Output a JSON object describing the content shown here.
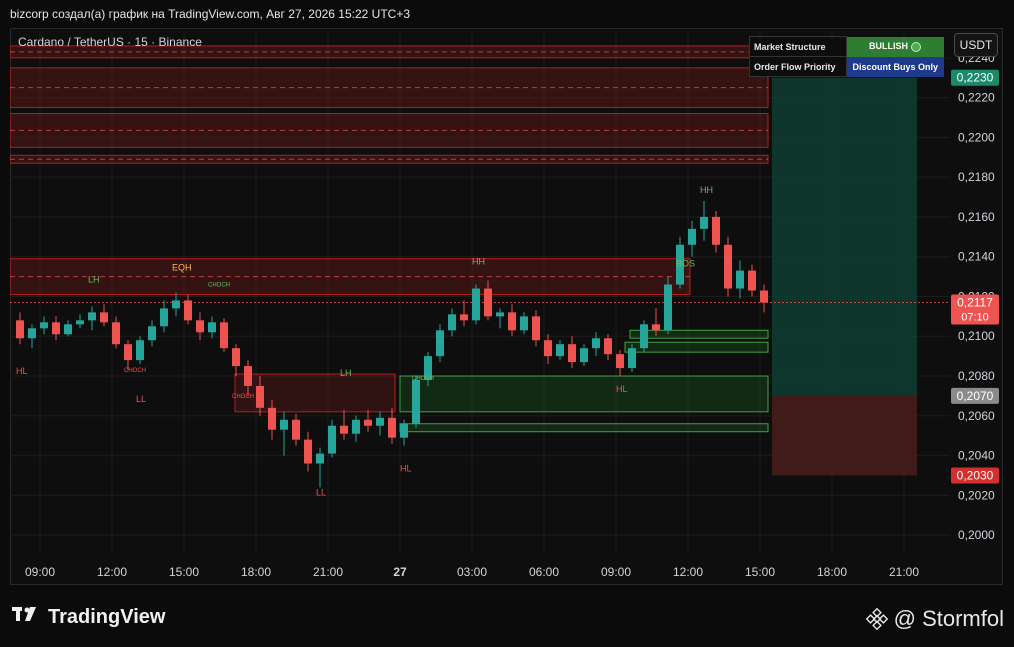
{
  "header": {
    "title": "bizcorp создал(а) график на TradingView.com, Авг 27, 2026 15:22 UTC+3"
  },
  "symbol": {
    "label": "Cardano / TetherUS · 15 · Binance"
  },
  "currency_button": "USDT",
  "info_table": {
    "row1_label": "Market Structure",
    "row1_value": "BULLISH",
    "row2_label": "Order Flow Priority",
    "row2_value": "Discount Buys Only",
    "colors": {
      "bullish": "#2e7d32",
      "discount": "#1e3a8a"
    }
  },
  "footer": {
    "brand": "TradingView",
    "author": "@ Stormfol"
  },
  "chart_data": {
    "type": "candlestick",
    "title": "Cardano / TetherUS · 15 · Binance",
    "ylim": [
      0.199,
      0.2255
    ],
    "y_ticks": [
      "0,2240",
      "0,2220",
      "0,2200",
      "0,2180",
      "0,2160",
      "0,2140",
      "0,2120",
      "0,2100",
      "0,2080",
      "0,2060",
      "0,2040",
      "0,2020",
      "0,2000"
    ],
    "x_ticks": [
      "09:00",
      "12:00",
      "15:00",
      "18:00",
      "21:00",
      "27",
      "03:00",
      "06:00",
      "09:00",
      "12:00",
      "15:00",
      "18:00",
      "21:00"
    ],
    "price_labels": {
      "target": "0,2230",
      "current": "0,2117",
      "countdown": "07:10",
      "entry": "0,2070",
      "stop": "0,2030"
    },
    "position": {
      "target": 0.223,
      "entry": 0.207,
      "stop": 0.203
    },
    "colors": {
      "up": "#26a69a",
      "down": "#ef5350",
      "bull_zone": "#1b5e20",
      "bear_zone": "#7f1d1d"
    },
    "annotations": [
      {
        "text": "HL",
        "color": "#ef5350",
        "t": 0,
        "price": 0.2081
      },
      {
        "text": "LH",
        "color": "#66bb6a",
        "t": 6,
        "price": 0.2127
      },
      {
        "text": "EQH",
        "color": "#ffb74d",
        "t": 13,
        "price": 0.2133
      },
      {
        "text": "CHOCH",
        "color": "#ef5350",
        "t": 9,
        "price": 0.2082
      },
      {
        "text": "CHOCH",
        "color": "#66bb6a",
        "t": 16,
        "price": 0.2125
      },
      {
        "text": "LL",
        "color": "#ef5350",
        "t": 10,
        "price": 0.2067
      },
      {
        "text": "CHOCH",
        "color": "#ef5350",
        "t": 18,
        "price": 0.2069
      },
      {
        "text": "LH",
        "color": "#66bb6a",
        "t": 27,
        "price": 0.208
      },
      {
        "text": "LL",
        "color": "#ef5350",
        "t": 25,
        "price": 0.202
      },
      {
        "text": "CHOCH",
        "color": "#66bb6a",
        "t": 33,
        "price": 0.2078
      },
      {
        "text": "HL",
        "color": "#ef5350",
        "t": 32,
        "price": 0.2032
      },
      {
        "text": "HH",
        "color": "#66bb6a",
        "t": 38,
        "price": 0.2136
      },
      {
        "text": "HL",
        "color": "#ef5350",
        "t": 50,
        "price": 0.2072
      },
      {
        "text": "HH",
        "color": "#66bb6a",
        "t": 57,
        "price": 0.2172
      },
      {
        "text": "BOS",
        "color": "#66bb6a",
        "t": 55,
        "price": 0.2135
      }
    ],
    "candles": [
      [
        0.2108,
        0.2112,
        0.2096,
        0.2099
      ],
      [
        0.2099,
        0.2106,
        0.2094,
        0.2104
      ],
      [
        0.2104,
        0.211,
        0.2101,
        0.2107
      ],
      [
        0.2107,
        0.211,
        0.2098,
        0.2101
      ],
      [
        0.2101,
        0.2108,
        0.21,
        0.2106
      ],
      [
        0.2106,
        0.2111,
        0.2104,
        0.2108
      ],
      [
        0.2108,
        0.2115,
        0.2103,
        0.2112
      ],
      [
        0.2112,
        0.2116,
        0.2105,
        0.2107
      ],
      [
        0.2107,
        0.211,
        0.2094,
        0.2096
      ],
      [
        0.2096,
        0.2098,
        0.2083,
        0.2088
      ],
      [
        0.2088,
        0.21,
        0.2086,
        0.2098
      ],
      [
        0.2098,
        0.2108,
        0.2095,
        0.2105
      ],
      [
        0.2105,
        0.2118,
        0.2102,
        0.2114
      ],
      [
        0.2114,
        0.2122,
        0.211,
        0.2118
      ],
      [
        0.2118,
        0.2121,
        0.2106,
        0.2108
      ],
      [
        0.2108,
        0.2112,
        0.2098,
        0.2102
      ],
      [
        0.2102,
        0.211,
        0.2099,
        0.2107
      ],
      [
        0.2107,
        0.2109,
        0.2092,
        0.2094
      ],
      [
        0.2094,
        0.2096,
        0.208,
        0.2085
      ],
      [
        0.2085,
        0.2088,
        0.207,
        0.2075
      ],
      [
        0.2075,
        0.208,
        0.206,
        0.2064
      ],
      [
        0.2064,
        0.2068,
        0.2048,
        0.2053
      ],
      [
        0.2053,
        0.2062,
        0.204,
        0.2058
      ],
      [
        0.2058,
        0.2061,
        0.2045,
        0.2048
      ],
      [
        0.2048,
        0.2052,
        0.2032,
        0.2036
      ],
      [
        0.2036,
        0.2044,
        0.2024,
        0.2041
      ],
      [
        0.2041,
        0.2058,
        0.2039,
        0.2055
      ],
      [
        0.2055,
        0.2063,
        0.2048,
        0.2051
      ],
      [
        0.2051,
        0.206,
        0.2047,
        0.2058
      ],
      [
        0.2058,
        0.2063,
        0.2052,
        0.2055
      ],
      [
        0.2055,
        0.2062,
        0.205,
        0.2059
      ],
      [
        0.2059,
        0.2064,
        0.2046,
        0.2049
      ],
      [
        0.2049,
        0.2058,
        0.2045,
        0.2056
      ],
      [
        0.2056,
        0.208,
        0.2054,
        0.2078
      ],
      [
        0.2078,
        0.2092,
        0.2075,
        0.209
      ],
      [
        0.209,
        0.2106,
        0.2087,
        0.2103
      ],
      [
        0.2103,
        0.2114,
        0.21,
        0.2111
      ],
      [
        0.2111,
        0.2118,
        0.2105,
        0.2108
      ],
      [
        0.2108,
        0.2126,
        0.2106,
        0.2124
      ],
      [
        0.2124,
        0.2128,
        0.2108,
        0.211
      ],
      [
        0.211,
        0.2114,
        0.2104,
        0.2112
      ],
      [
        0.2112,
        0.2116,
        0.21,
        0.2103
      ],
      [
        0.2103,
        0.2112,
        0.2101,
        0.211
      ],
      [
        0.211,
        0.2113,
        0.2095,
        0.2098
      ],
      [
        0.2098,
        0.2101,
        0.2086,
        0.209
      ],
      [
        0.209,
        0.2098,
        0.2088,
        0.2096
      ],
      [
        0.2096,
        0.21,
        0.2084,
        0.2087
      ],
      [
        0.2087,
        0.2096,
        0.2085,
        0.2094
      ],
      [
        0.2094,
        0.2102,
        0.209,
        0.2099
      ],
      [
        0.2099,
        0.2101,
        0.2088,
        0.2091
      ],
      [
        0.2091,
        0.2093,
        0.208,
        0.2084
      ],
      [
        0.2084,
        0.2096,
        0.2082,
        0.2094
      ],
      [
        0.2094,
        0.2108,
        0.2092,
        0.2106
      ],
      [
        0.2106,
        0.2114,
        0.21,
        0.2103
      ],
      [
        0.2103,
        0.213,
        0.2101,
        0.2126
      ],
      [
        0.2126,
        0.215,
        0.2124,
        0.2146
      ],
      [
        0.2146,
        0.2158,
        0.214,
        0.2154
      ],
      [
        0.2154,
        0.2168,
        0.2148,
        0.216
      ],
      [
        0.216,
        0.2163,
        0.2142,
        0.2146
      ],
      [
        0.2146,
        0.215,
        0.212,
        0.2124
      ],
      [
        0.2124,
        0.2138,
        0.2119,
        0.2133
      ],
      [
        0.2133,
        0.2136,
        0.212,
        0.2123
      ],
      [
        0.2123,
        0.2126,
        0.2112,
        0.2117
      ]
    ]
  }
}
